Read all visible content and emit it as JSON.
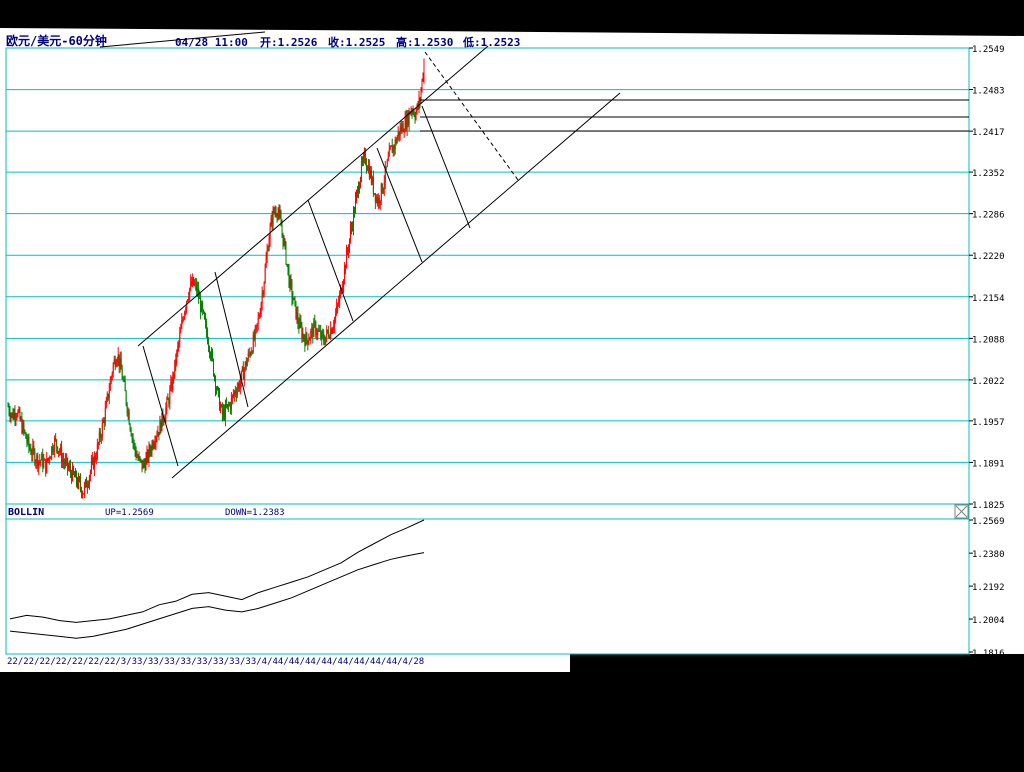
{
  "header": {
    "symbol": "欧元/美元-60分钟",
    "datetime": "04/28  11:00",
    "open": "开:1.2526",
    "close": "收:1.2525",
    "high": "高:1.2530",
    "low": "低:1.2523"
  },
  "indicator": {
    "name": "BOLLIN",
    "up": "UP=1.2569",
    "down": "DOWN=1.2383"
  },
  "x_axis_label": "22/22/22/22/22/22/22/3/33/33/33/33/33/33/33/33/4/44/44/44/44/44/44/44/44/4/28",
  "colors": {
    "background": "#ffffff",
    "grid": "#00c0c0",
    "header_text": "#000080",
    "candle_up": "#ff0000",
    "candle_down": "#008000",
    "lines": "#000000"
  },
  "chart_data": [
    {
      "type": "candlestick",
      "title": "欧元/美元-60分钟",
      "y_ticks": [
        1.2549,
        1.2483,
        1.2417,
        1.2352,
        1.2286,
        1.222,
        1.2154,
        1.2088,
        1.2022,
        1.1957,
        1.1891,
        1.1825
      ],
      "ylim": [
        1.1825,
        1.2549
      ],
      "grid": true,
      "close_path": [
        1.198,
        1.1965,
        1.1975,
        1.1955,
        1.1935,
        1.1915,
        1.1905,
        1.1895,
        1.1895,
        1.1885,
        1.1905,
        1.1925,
        1.1915,
        1.1895,
        1.1885,
        1.1875,
        1.1865,
        1.1855,
        1.1845,
        1.1865,
        1.1885,
        1.1905,
        1.1935,
        1.1965,
        1.2005,
        1.2045,
        1.2065,
        1.2035,
        1.1995,
        1.1955,
        1.1915,
        1.1895,
        1.1885,
        1.1895,
        1.1915,
        1.1935,
        1.1945,
        1.1965,
        1.1985,
        1.2015,
        1.2055,
        1.2095,
        1.2135,
        1.2165,
        1.2175,
        1.2165,
        1.2135,
        1.2105,
        1.2075,
        1.2035,
        1.1995,
        1.1965,
        1.1975,
        1.1985,
        1.2005,
        1.2015,
        1.2035,
        1.2055,
        1.2075,
        1.2095,
        1.2135,
        1.2185,
        1.2245,
        1.2285,
        1.2295,
        1.2265,
        1.2225,
        1.2175,
        1.2145,
        1.2115,
        1.2095,
        1.2085,
        1.2095,
        1.2105,
        1.2095,
        1.2085,
        1.2095,
        1.2105,
        1.2125,
        1.2155,
        1.2195,
        1.2235,
        1.2275,
        1.2315,
        1.2355,
        1.2375,
        1.2355,
        1.2325,
        1.2305,
        1.2325,
        1.2355,
        1.2385,
        1.2395,
        1.2415,
        1.2425,
        1.2435,
        1.2455,
        1.2445,
        1.2465,
        1.2525
      ],
      "annotations": [
        "upper trend channel line",
        "lower trend channel line",
        "zigzag wave lines",
        "dashed projection line",
        "horizontal resistance lines"
      ]
    },
    {
      "type": "line",
      "title": "BOLLIN",
      "y_ticks": [
        1.2569,
        1.238,
        1.2192,
        1.2004,
        1.1816
      ],
      "ylim": [
        1.1816,
        1.2569
      ],
      "series": [
        {
          "name": "UP",
          "values": [
            1.2005,
            1.2025,
            1.2015,
            1.1995,
            1.1985,
            1.1995,
            1.2005,
            1.2025,
            1.2045,
            1.2085,
            1.2105,
            1.2145,
            1.2155,
            1.2135,
            1.2115,
            1.2155,
            1.2185,
            1.2215,
            1.2245,
            1.2285,
            1.2325,
            1.2385,
            1.2435,
            1.2485,
            1.2525,
            1.2569
          ]
        },
        {
          "name": "DOWN",
          "values": [
            1.1935,
            1.1925,
            1.1915,
            1.1905,
            1.1895,
            1.1905,
            1.1925,
            1.1945,
            1.1975,
            1.2005,
            1.2035,
            1.2065,
            1.2075,
            1.2055,
            1.2045,
            1.2065,
            1.2095,
            1.2125,
            1.2165,
            1.2205,
            1.2245,
            1.2285,
            1.2315,
            1.2345,
            1.2365,
            1.2383
          ]
        }
      ]
    }
  ]
}
